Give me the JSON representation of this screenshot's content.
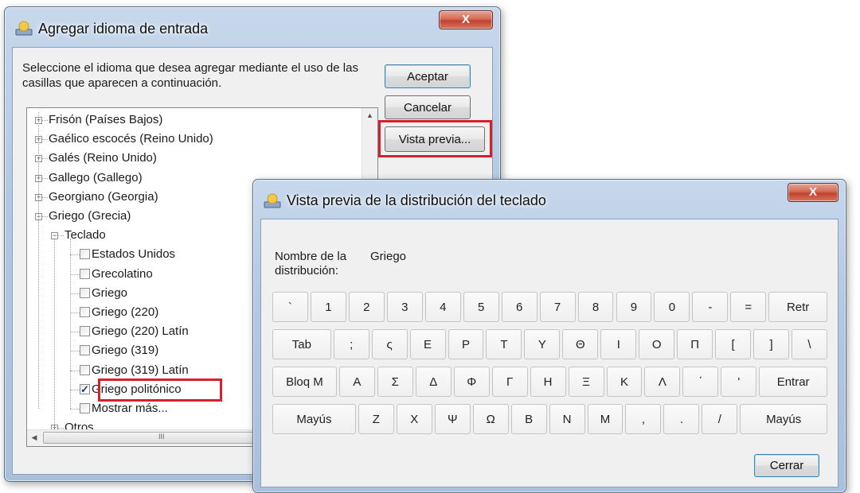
{
  "dialog1": {
    "title": "Agregar idioma de entrada",
    "close_label": "X",
    "instructions": "Seleccione el idioma que desea agregar mediante el uso de las casillas que aparecen a continuación.",
    "buttons": {
      "ok": "Aceptar",
      "cancel": "Cancelar",
      "preview": "Vista previa..."
    },
    "tree": {
      "items": [
        {
          "label": "Frisón (Países Bajos)",
          "expander": "+"
        },
        {
          "label": "Gaélico escocés (Reino Unido)",
          "expander": "+"
        },
        {
          "label": "Galés (Reino Unido)",
          "expander": "+"
        },
        {
          "label": "Gallego (Gallego)",
          "expander": "+"
        },
        {
          "label": "Georgiano (Georgia)",
          "expander": "+"
        },
        {
          "label": "Griego (Grecia)",
          "expander": "−"
        },
        {
          "label": "Teclado",
          "expander": "−"
        },
        {
          "label": "Estados Unidos",
          "checked": false
        },
        {
          "label": "Grecolatino",
          "checked": false
        },
        {
          "label": "Griego",
          "checked": false
        },
        {
          "label": "Griego (220)",
          "checked": false
        },
        {
          "label": "Griego (220) Latín",
          "checked": false
        },
        {
          "label": "Griego (319)",
          "checked": false
        },
        {
          "label": "Griego (319) Latín",
          "checked": false
        },
        {
          "label": "Griego politónico",
          "checked": true
        },
        {
          "label": "Mostrar más...",
          "checked": false
        },
        {
          "label": "Otros",
          "expander": "+"
        }
      ],
      "scroll_up_glyph": "▲",
      "scroll_left_glyph": "◀",
      "scroll_grip_glyph": "III"
    }
  },
  "dialog2": {
    "title": "Vista previa de la distribución del teclado",
    "close_label": "X",
    "layout_name_label": "Nombre de la distribución:",
    "layout_name_value": "Griego",
    "close_button": "Cerrar",
    "rows": [
      [
        "`",
        "1",
        "2",
        "3",
        "4",
        "5",
        "6",
        "7",
        "8",
        "9",
        "0",
        "-",
        "=",
        "Retr"
      ],
      [
        "Tab",
        ";",
        "ς",
        "Ε",
        "Ρ",
        "Τ",
        "Υ",
        "Θ",
        "Ι",
        "Ο",
        "Π",
        "[",
        "]",
        "\\"
      ],
      [
        "Bloq M",
        "Α",
        "Σ",
        "Δ",
        "Φ",
        "Γ",
        "Η",
        "Ξ",
        "Κ",
        "Λ",
        "΄",
        "'",
        "Entrar"
      ],
      [
        "Mayús",
        "Ζ",
        "Χ",
        "Ψ",
        "Ω",
        "Β",
        "Ν",
        "Μ",
        ",",
        ".",
        "/",
        "Mayús"
      ]
    ]
  },
  "colors": {
    "highlight_red": "#d8202a",
    "title_glass": "#b3c8e2",
    "close_red": "#c1422c"
  }
}
